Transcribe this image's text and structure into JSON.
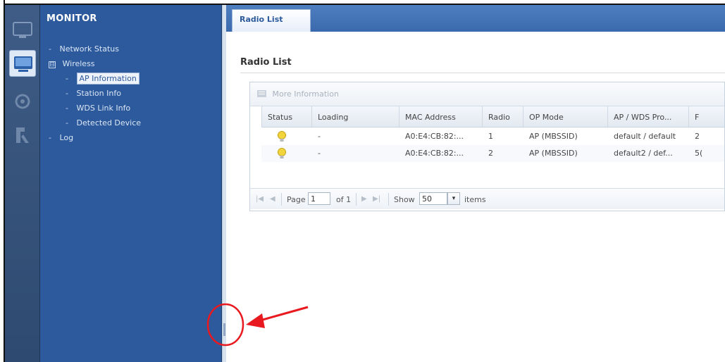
{
  "nav": {
    "title": "MONITOR",
    "items": [
      {
        "label": "Network Status",
        "level": 0,
        "type": "bullet"
      },
      {
        "label": "Wireless",
        "level": 0,
        "type": "expander",
        "toggle": "⊟"
      },
      {
        "label": "AP Information",
        "level": 1,
        "type": "bullet",
        "selected": true
      },
      {
        "label": "Station Info",
        "level": 1,
        "type": "bullet"
      },
      {
        "label": "WDS Link Info",
        "level": 1,
        "type": "bullet"
      },
      {
        "label": "Detected Device",
        "level": 1,
        "type": "bullet"
      },
      {
        "label": "Log",
        "level": 0,
        "type": "bullet"
      }
    ]
  },
  "rail": {
    "icons": [
      "dashboard-icon",
      "monitor-icon",
      "configuration-icon",
      "maintenance-icon"
    ],
    "active": "monitor-icon"
  },
  "tab": {
    "label": "Radio List"
  },
  "section": {
    "title": "Radio List"
  },
  "toolbar": {
    "more_info_label": "More Information"
  },
  "table": {
    "headers": [
      "Status",
      "Loading",
      "MAC Address",
      "Radio",
      "OP Mode",
      "AP / WDS Pro...",
      "F"
    ],
    "rows": [
      {
        "status": "bulb-icon",
        "loading": "-",
        "mac": "A0:E4:CB:82:...",
        "radio": "1",
        "op_mode": "AP (MBSSID)",
        "profile": "default / default",
        "f": "2"
      },
      {
        "status": "bulb-icon",
        "loading": "-",
        "mac": "A0:E4:CB:82:...",
        "radio": "2",
        "op_mode": "AP (MBSSID)",
        "profile": "default2 / def...",
        "f": "5("
      }
    ]
  },
  "pager": {
    "page_label": "Page",
    "page_value": "1",
    "of_label": "of 1",
    "show_label": "Show",
    "show_value": "50",
    "items_label": "items"
  },
  "colors": {
    "nav_bg": "#2d5a9c",
    "tabstrip": "#3a69ad",
    "annotation": "#e8191f",
    "bulb": "#f2d43c"
  }
}
